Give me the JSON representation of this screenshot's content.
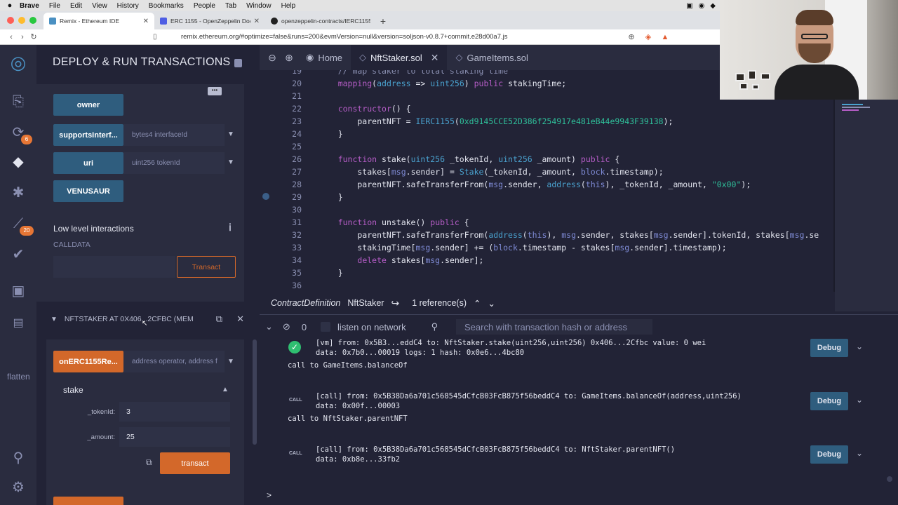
{
  "menubar": {
    "brand": "Brave",
    "items": [
      "File",
      "Edit",
      "View",
      "History",
      "Bookmarks",
      "People",
      "Tab",
      "Window",
      "Help"
    ]
  },
  "browser_tabs": [
    {
      "label": "Remix - Ethereum IDE",
      "active": true
    },
    {
      "label": "ERC 1155 - OpenZeppelin Docs",
      "active": false
    },
    {
      "label": "openzeppelin-contracts/IERC1155R",
      "active": false
    }
  ],
  "address": {
    "url": "remix.ethereum.org/#optimize=false&runs=200&evmVersion=null&version=soljson-v0.8.7+commit.e28d00a7.js"
  },
  "sidebar": {
    "badges": {
      "compile": "6",
      "analysis": "20"
    },
    "flatten_label": "flatten"
  },
  "panel": {
    "title": "DEPLOY & RUN TRANSACTIONS",
    "functions_top": [
      {
        "label": "owner",
        "input": "",
        "color": "blue"
      },
      {
        "label": "supportsInterf...",
        "input": "bytes4 interfaceId",
        "color": "blue"
      },
      {
        "label": "uri",
        "input": "uint256 tokenId",
        "color": "blue"
      },
      {
        "label": "VENUSAUR",
        "input": "",
        "color": "blue"
      }
    ],
    "low_level": {
      "title": "Low level interactions",
      "calldata_label": "CALLDATA",
      "transact_label": "Transact"
    },
    "instance": {
      "label": "NFTSTAKER AT 0X406...2CFBC (MEM"
    },
    "functions_bottom": {
      "on_received": {
        "label": "onERC1155Re...",
        "input": "address operator, address f"
      },
      "stake": {
        "title": "stake",
        "params": [
          {
            "label": "_tokenId:",
            "value": "3"
          },
          {
            "label": "_amount:",
            "value": "25"
          }
        ],
        "transact_label": "transact"
      }
    }
  },
  "editor": {
    "tabs": [
      {
        "label": "Home",
        "active": false
      },
      {
        "label": "NftStaker.sol",
        "active": true
      },
      {
        "label": "GameItems.sol",
        "active": false
      }
    ],
    "lines": [
      {
        "n": "19",
        "text": "    // map staker to total staking time"
      },
      {
        "n": "20",
        "text": "    mapping(address => uint256) public stakingTime;"
      },
      {
        "n": "21",
        "text": ""
      },
      {
        "n": "22",
        "text": "    constructor() {"
      },
      {
        "n": "23",
        "text": "        parentNFT = IERC1155(0xd9145CCE52D386f254917e481eB44e9943F39138);"
      },
      {
        "n": "24",
        "text": "    }"
      },
      {
        "n": "25",
        "text": ""
      },
      {
        "n": "26",
        "text": "    function stake(uint256 _tokenId, uint256 _amount) public {"
      },
      {
        "n": "27",
        "text": "        stakes[msg.sender] = Stake(_tokenId, _amount, block.timestamp);"
      },
      {
        "n": "28",
        "text": "        parentNFT.safeTransferFrom(msg.sender, address(this), _tokenId, _amount, \"0x00\");"
      },
      {
        "n": "29",
        "text": "    }"
      },
      {
        "n": "30",
        "text": ""
      },
      {
        "n": "31",
        "text": "    function unstake() public {"
      },
      {
        "n": "32",
        "text": "        parentNFT.safeTransferFrom(address(this), msg.sender, stakes[msg.sender].tokenId, stakes[msg.se"
      },
      {
        "n": "33",
        "text": "        stakingTime[msg.sender] += (block.timestamp - stakes[msg.sender].timestamp);"
      },
      {
        "n": "34",
        "text": "        delete stakes[msg.sender];"
      },
      {
        "n": "35",
        "text": "    }"
      },
      {
        "n": "36",
        "text": ""
      }
    ],
    "refbar": {
      "kind": "ContractDefinition",
      "name": "NftStaker",
      "refs": "1 reference(s)"
    }
  },
  "terminal": {
    "count": "0",
    "listen_label": "listen on network",
    "search_placeholder": "Search with transaction hash or address",
    "logs": [
      {
        "tag": "check",
        "line1": "[vm] from: 0x5B3...eddC4 to: NftStaker.stake(uint256,uint256) 0x406...2Cfbc value: 0 wei",
        "line2": "data: 0x7b0...00019 logs: 1 hash: 0x0e6...4bc80",
        "after": "call to GameItems.balanceOf",
        "debug": "Debug"
      },
      {
        "tag": "CALL",
        "line1": "[call] from: 0x5B38Da6a701c568545dCfcB03FcB875f56beddC4 to: GameItems.balanceOf(address,uint256)",
        "line2": "data: 0x00f...00003",
        "after": "call to NftStaker.parentNFT",
        "debug": "Debug"
      },
      {
        "tag": "CALL",
        "line1": "[call] from: 0x5B38Da6a701c568545dCfcB03FcB875f56beddC4 to: NftStaker.parentNFT()",
        "line2": "data: 0xb8e...33fb2",
        "after": "",
        "debug": "Debug"
      }
    ],
    "prompt": ">"
  },
  "colors": {
    "accent_orange": "#d3682a",
    "button_blue": "#2f5d7e",
    "bg": "#222336",
    "panel_bg": "#2a2c3f"
  }
}
